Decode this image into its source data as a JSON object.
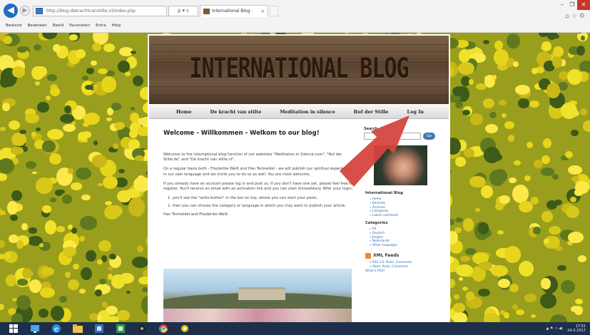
{
  "browser": {
    "url": "http://blog.dakrachtvanstilte.nl/index.php",
    "address_tools": "ρ ▾ c",
    "tab_title": "International Blog -",
    "tab_close": "×",
    "menu": [
      "Bestand",
      "Bewerken",
      "Beeld",
      "Favorieten",
      "Extra",
      "Help"
    ],
    "window_controls": [
      "–",
      "❐",
      "✕"
    ],
    "tools_icons": "⌂☆⚙"
  },
  "site": {
    "title": "INTERNATIONAL BLOG",
    "nav": [
      "Home",
      "De kracht van stilte",
      "Meditation in silence",
      "Ruf der Stille",
      "Log In"
    ]
  },
  "post": {
    "title": "Welcome - Willkommen - Welkom to our blog!",
    "paragraphs": [
      "Welcome to the international blog function of our websites \"Meditation in Silence.com\", \"Ruf der Stille.de\" and \"De kracht van stilte.nl\".",
      "On a regular basis both - Friederike Weiß and Han Termeldel - we will publish our spiritual experiences in our own language and we invite you to do so as well. You are most welcome.",
      "If you already have an account please log in and post us. If you don't have one yet, please feel free to register. You'll receive an email with an activation link and you can start immediately. After your login:"
    ],
    "list": [
      "1. you'll see the \"write button\" in the bar on top, where you can start your posts.",
      "2. then you can choose the category or language in which you may want to publish your article."
    ],
    "signature": "Han Termeldel and Friederike Weiß."
  },
  "sidebar": {
    "search_label": "Search",
    "search_button": "Go",
    "blog_heading": "International Blog",
    "blog_links": [
      "» Home",
      "» Recently",
      "» Archives",
      "» Categories",
      "» Latest comments"
    ],
    "categories_heading": "Categories",
    "categories": [
      "» All",
      "» Deutsch",
      "» English",
      "» Nederlands",
      "» Other languages"
    ],
    "xml_heading": "XML Feeds",
    "feeds": [
      "» RSS 2.0: Posts, Comments",
      "» Atom: Posts, Comments"
    ],
    "feeds_more": "What is RSS?"
  },
  "taskbar": {
    "tray": "▲ ⚑ ▭ ◀)",
    "time": "17:51",
    "date": "24-2-2017"
  },
  "colors": {
    "arrow": "#d64540",
    "nav_bg": "#e6e6e6",
    "link": "#2b6bb0",
    "taskbar": "#1d2f4a"
  }
}
